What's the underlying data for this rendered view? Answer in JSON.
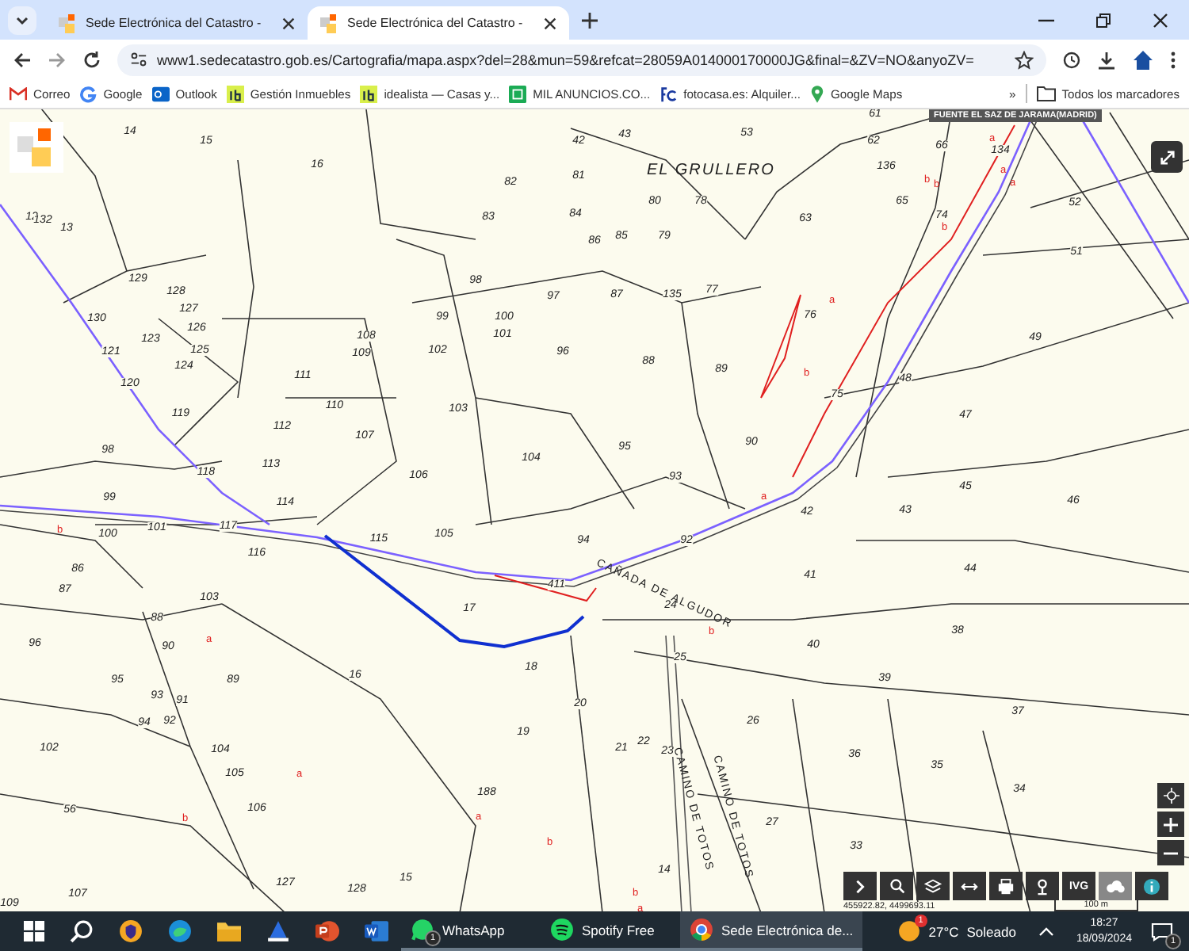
{
  "tabs": [
    {
      "title": "Sede Electrónica del Catastro -",
      "selected": false
    },
    {
      "title": "Sede Electrónica del Catastro -",
      "selected": true
    }
  ],
  "address": "www1.sedecatastro.gob.es/Cartografia/mapa.aspx?del=28&mun=59&refcat=28059A014000170000JG&final=&ZV=NO&anyoZV=",
  "bookmarks": [
    {
      "label": "Correo",
      "kind": "mail"
    },
    {
      "label": "Google",
      "kind": "google"
    },
    {
      "label": "Outlook",
      "kind": "outlook"
    },
    {
      "label": "Gestión Inmuebles",
      "kind": "id"
    },
    {
      "label": "idealista — Casas y...",
      "kind": "id"
    },
    {
      "label": "MIL ANUNCIOS.CO...",
      "kind": "mil"
    },
    {
      "label": "fotocasa.es: Alquiler...",
      "kind": "fc"
    },
    {
      "label": "Google Maps",
      "kind": "maps"
    }
  ],
  "bookmarks_overflow": "»",
  "all_bookmarks": "Todos los marcadores",
  "map": {
    "municipality": "FUENTE EL SAZ DE JARAMA(MADRID)",
    "place_names": [
      "EL GRULLERO",
      "CAÑADA DE ALGUDOR",
      "CAMINO DE TOTOS",
      "CAMINO DE TOTOS"
    ],
    "parcels": [
      "14",
      "15",
      "16",
      "42",
      "43",
      "53",
      "61",
      "62",
      "66",
      "136",
      "134",
      "65",
      "74",
      "52",
      "51",
      "63",
      "81",
      "82",
      "83",
      "84",
      "85",
      "86",
      "80",
      "78",
      "79",
      "87",
      "135",
      "77",
      "76",
      "97",
      "98",
      "99",
      "100",
      "101",
      "102",
      "96",
      "88",
      "89",
      "75",
      "48",
      "49",
      "47",
      "108",
      "109",
      "111",
      "110",
      "103",
      "104",
      "95",
      "90",
      "107",
      "112",
      "113",
      "106",
      "93",
      "118",
      "119",
      "98",
      "99",
      "120",
      "121",
      "123",
      "124",
      "126",
      "125",
      "127",
      "128",
      "129",
      "130",
      "12",
      "132",
      "13",
      "42",
      "43",
      "45",
      "46",
      "44",
      "41",
      "114",
      "115",
      "105",
      "101",
      "100",
      "117",
      "116",
      "94",
      "92",
      "17",
      "24",
      "38",
      "40",
      "39",
      "37",
      "25",
      "18",
      "20",
      "16",
      "19",
      "21",
      "22",
      "23",
      "26",
      "36",
      "35",
      "34",
      "27",
      "33",
      "188",
      "14",
      "15",
      "128",
      "127",
      "107",
      "109",
      "56",
      "102",
      "96",
      "87",
      "86",
      "88",
      "90",
      "95",
      "93",
      "91",
      "89",
      "94",
      "92",
      "103",
      "104",
      "105",
      "106",
      "411"
    ],
    "subparcels": [
      "a",
      "b",
      "b",
      "a",
      "a",
      "b",
      "a",
      "b",
      "a",
      "a",
      "b",
      "b",
      "a",
      "b",
      "b",
      "a",
      "b",
      "a"
    ],
    "coordinates": "455922.82, 4499693.11",
    "scale": "100 m",
    "tool_label": "IVG"
  },
  "taskbar": {
    "apps": [
      {
        "label": "WhatsApp",
        "kind": "whatsapp",
        "badge": "1",
        "selected": false
      },
      {
        "label": "Spotify Free",
        "kind": "spotify",
        "selected": false
      },
      {
        "label": "Sede Electrónica de...",
        "kind": "chrome",
        "selected": true
      }
    ],
    "weather_badge": "1",
    "temperature": "27°C",
    "weather": "Soleado",
    "time": "18:27",
    "date": "18/09/2024",
    "notifications": "1"
  }
}
